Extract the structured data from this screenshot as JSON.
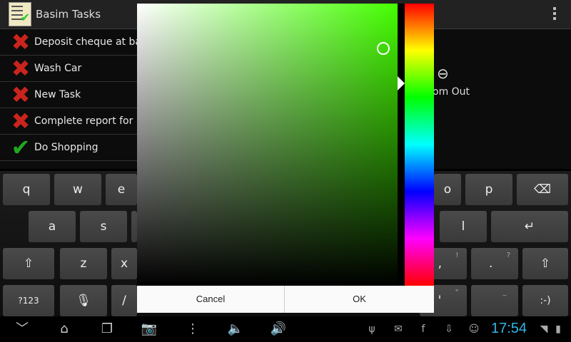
{
  "app": {
    "title": "Basim Tasks"
  },
  "tasks": [
    {
      "label": "Deposit cheque at bank",
      "status": "cross"
    },
    {
      "label": "Wash Car",
      "status": "cross"
    },
    {
      "label": "New Task",
      "status": "cross"
    },
    {
      "label": "Complete report for Frid",
      "status": "cross"
    },
    {
      "label": "Do Shopping",
      "status": "tick"
    }
  ],
  "zoom": {
    "label": "om Out"
  },
  "dialog": {
    "cancel": "Cancel",
    "ok": "OK",
    "selected_color": "#44ff00"
  },
  "keyboard": {
    "row1": [
      "q",
      "w",
      "e",
      "o",
      "p"
    ],
    "row2": [
      "a",
      "s",
      "l"
    ],
    "row3": [
      "z",
      "x",
      ",",
      "."
    ],
    "row3_hints": [
      "!",
      "?"
    ],
    "row4": [
      "?123",
      "/",
      "'",
      "-)"
    ],
    "row4_hints": [
      "\"",
      "_"
    ],
    "smiley": ":-)"
  },
  "status": {
    "time": "17:54"
  },
  "colors": {
    "clock": "#33b5e5",
    "cross": "#c9241d",
    "tick": "#1faa1f"
  }
}
